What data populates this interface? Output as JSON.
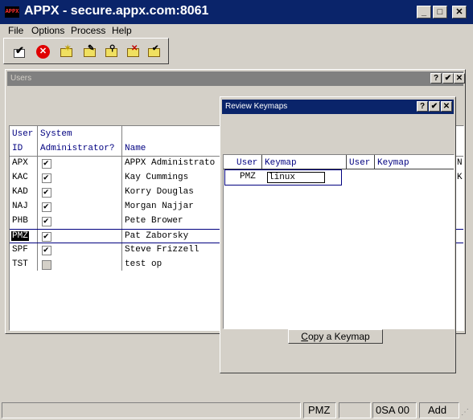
{
  "window": {
    "title": "APPX - secure.appx.com:8061",
    "icon_text": "APPX"
  },
  "menu": [
    {
      "label": "File",
      "underline": "F"
    },
    {
      "label": "Options",
      "underline": "O"
    },
    {
      "label": "Process",
      "underline": "P"
    },
    {
      "label": "Help",
      "underline": "H"
    }
  ],
  "toolbar": {
    "icons": [
      "check-icon",
      "cancel-icon",
      "new-folder-icon",
      "edit-folder-icon",
      "search-folder-icon",
      "delete-folder-icon",
      "check-folder-icon"
    ],
    "cancel_color": "#e00000"
  },
  "users_window": {
    "title": "Users",
    "columns": {
      "user_id_line1": "User",
      "user_id_line2": "ID",
      "sysadmin_line1": "System",
      "sysadmin_line2": "Administrator?",
      "name": "Name"
    },
    "rows": [
      {
        "id": "APX",
        "admin": true,
        "name": "APPX Administrato",
        "trail": "N"
      },
      {
        "id": "KAC",
        "admin": true,
        "name": "Kay Cummings",
        "trail": "K"
      },
      {
        "id": "KAD",
        "admin": true,
        "name": "Korry Douglas",
        "trail": ""
      },
      {
        "id": "NAJ",
        "admin": true,
        "name": "Morgan Najjar",
        "trail": ""
      },
      {
        "id": "PHB",
        "admin": true,
        "name": "Pete Brower",
        "trail": ""
      },
      {
        "id": "PMZ",
        "admin": true,
        "name": "Pat Zaborsky",
        "trail": "",
        "selected": true
      },
      {
        "id": "SPF",
        "admin": true,
        "name": "Steve Frizzell",
        "trail": ""
      },
      {
        "id": "TST",
        "admin": false,
        "name": "test op",
        "trail": ""
      }
    ]
  },
  "dialog": {
    "title": "Review Keymaps",
    "columns": {
      "user1": "User",
      "keymap1": "Keymap",
      "user2": "User",
      "keymap2": "Keymap"
    },
    "row": {
      "user": "PMZ",
      "keymap": "linux"
    },
    "copy_button": {
      "before": "",
      "accel": "C",
      "after": "opy a Keymap"
    }
  },
  "status": {
    "user": "PMZ",
    "blank": "",
    "code": "0SA 00",
    "mode": "Add"
  },
  "colors": {
    "title_active": "#0a246a",
    "title_inactive": "#808080",
    "header_text": "#000080",
    "face": "#d4d0c8"
  }
}
